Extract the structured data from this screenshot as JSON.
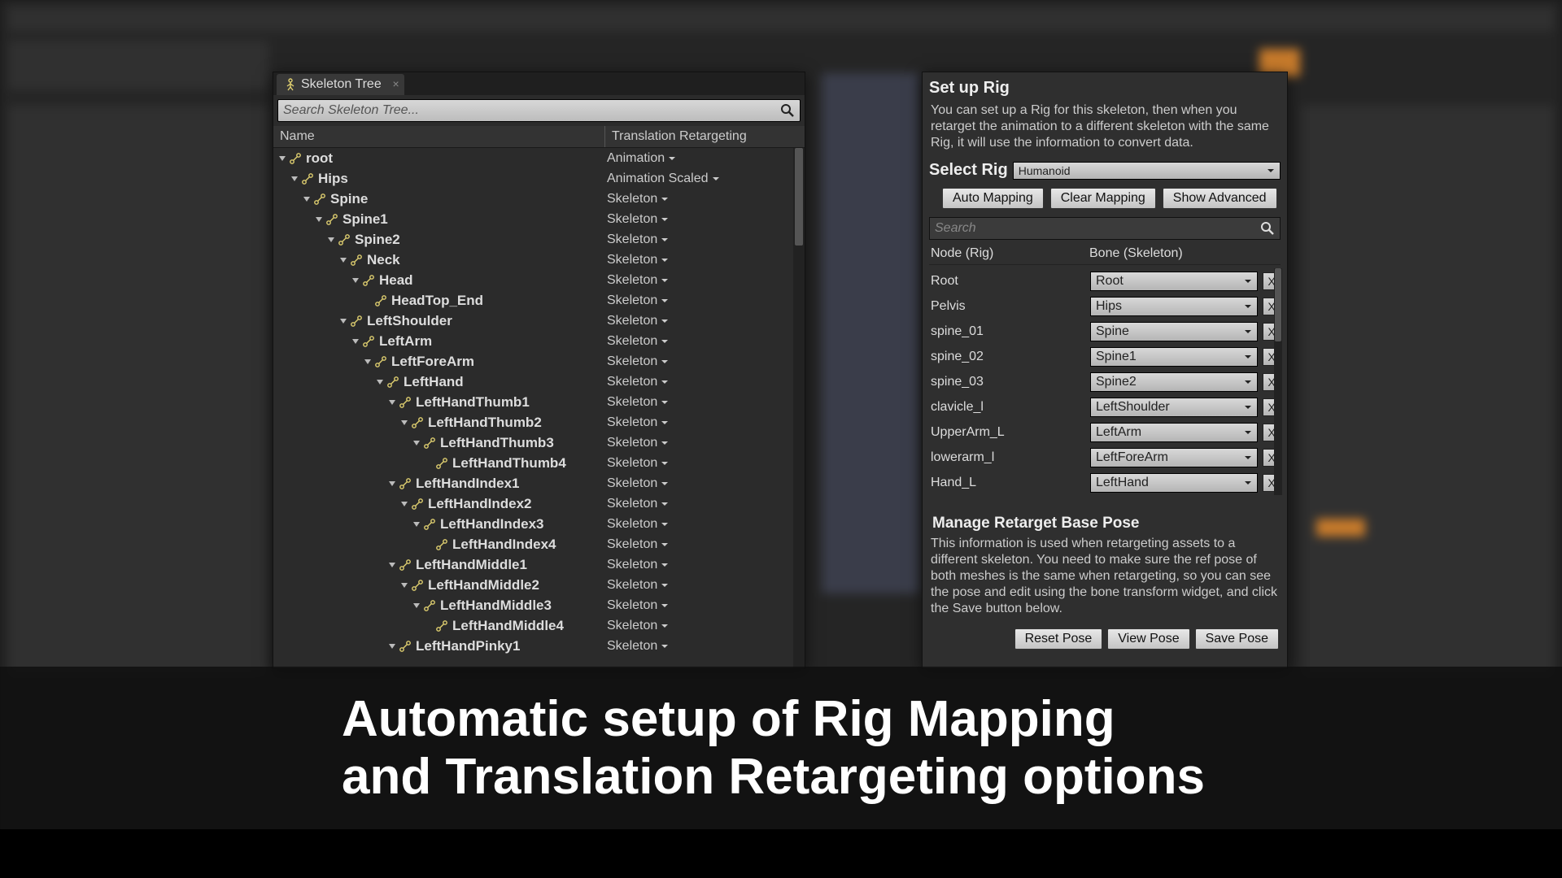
{
  "caption": "Automatic setup of Rig Mapping\nand Translation Retargeting options",
  "skeletonPanel": {
    "tabTitle": "Skeleton Tree",
    "searchPlaceholder": "Search Skeleton Tree...",
    "columns": {
      "name": "Name",
      "retarget": "Translation Retargeting"
    },
    "bones": [
      {
        "name": "root",
        "indent": 0,
        "ret": "Animation",
        "expanded": true
      },
      {
        "name": "Hips",
        "indent": 1,
        "ret": "Animation Scaled",
        "expanded": true
      },
      {
        "name": "Spine",
        "indent": 2,
        "ret": "Skeleton",
        "expanded": true
      },
      {
        "name": "Spine1",
        "indent": 3,
        "ret": "Skeleton",
        "expanded": true
      },
      {
        "name": "Spine2",
        "indent": 4,
        "ret": "Skeleton",
        "expanded": true
      },
      {
        "name": "Neck",
        "indent": 5,
        "ret": "Skeleton",
        "expanded": true
      },
      {
        "name": "Head",
        "indent": 6,
        "ret": "Skeleton",
        "expanded": true
      },
      {
        "name": "HeadTop_End",
        "indent": 7,
        "ret": "Skeleton",
        "expanded": false,
        "leaf": true
      },
      {
        "name": "LeftShoulder",
        "indent": 5,
        "ret": "Skeleton",
        "expanded": true
      },
      {
        "name": "LeftArm",
        "indent": 6,
        "ret": "Skeleton",
        "expanded": true
      },
      {
        "name": "LeftForeArm",
        "indent": 7,
        "ret": "Skeleton",
        "expanded": true
      },
      {
        "name": "LeftHand",
        "indent": 8,
        "ret": "Skeleton",
        "expanded": true
      },
      {
        "name": "LeftHandThumb1",
        "indent": 9,
        "ret": "Skeleton",
        "expanded": true
      },
      {
        "name": "LeftHandThumb2",
        "indent": 10,
        "ret": "Skeleton",
        "expanded": true
      },
      {
        "name": "LeftHandThumb3",
        "indent": 11,
        "ret": "Skeleton",
        "expanded": true
      },
      {
        "name": "LeftHandThumb4",
        "indent": 12,
        "ret": "Skeleton",
        "expanded": false,
        "leaf": true
      },
      {
        "name": "LeftHandIndex1",
        "indent": 9,
        "ret": "Skeleton",
        "expanded": true
      },
      {
        "name": "LeftHandIndex2",
        "indent": 10,
        "ret": "Skeleton",
        "expanded": true
      },
      {
        "name": "LeftHandIndex3",
        "indent": 11,
        "ret": "Skeleton",
        "expanded": true
      },
      {
        "name": "LeftHandIndex4",
        "indent": 12,
        "ret": "Skeleton",
        "expanded": false,
        "leaf": true
      },
      {
        "name": "LeftHandMiddle1",
        "indent": 9,
        "ret": "Skeleton",
        "expanded": true
      },
      {
        "name": "LeftHandMiddle2",
        "indent": 10,
        "ret": "Skeleton",
        "expanded": true
      },
      {
        "name": "LeftHandMiddle3",
        "indent": 11,
        "ret": "Skeleton",
        "expanded": true
      },
      {
        "name": "LeftHandMiddle4",
        "indent": 12,
        "ret": "Skeleton",
        "expanded": false,
        "leaf": true
      },
      {
        "name": "LeftHandPinky1",
        "indent": 9,
        "ret": "Skeleton",
        "expanded": true
      }
    ]
  },
  "rigPanel": {
    "title": "Set up Rig",
    "desc": "You can set up a Rig for this skeleton, then when you retarget the animation to a different skeleton with the same Rig, it will use the information to convert data.",
    "selectRigLabel": "Select Rig",
    "selectRigValue": "Humanoid",
    "buttons": {
      "auto": "Auto  Mapping",
      "clear": "Clear Mapping",
      "advanced": "Show Advanced"
    },
    "searchPlaceholder": "Search",
    "columns": {
      "node": "Node (Rig)",
      "bone": "Bone (Skeleton)"
    },
    "mappings": [
      {
        "node": "Root",
        "bone": "Root"
      },
      {
        "node": "Pelvis",
        "bone": "Hips"
      },
      {
        "node": "spine_01",
        "bone": "Spine"
      },
      {
        "node": "spine_02",
        "bone": "Spine1"
      },
      {
        "node": "spine_03",
        "bone": "Spine2"
      },
      {
        "node": "clavicle_l",
        "bone": "LeftShoulder"
      },
      {
        "node": "UpperArm_L",
        "bone": "LeftArm"
      },
      {
        "node": "lowerarm_l",
        "bone": "LeftForeArm"
      },
      {
        "node": "Hand_L",
        "bone": "LeftHand"
      }
    ],
    "poseTitle": "Manage Retarget Base Pose",
    "poseDesc": "This information is used when retargeting assets to a different skeleton. You need to make sure the ref pose of both meshes is the same when retargeting, so you can see the pose and edit using the bone transform widget, and click the Save button below.",
    "poseButtons": {
      "reset": "Reset Pose",
      "view": "View Pose",
      "save": "Save Pose"
    }
  }
}
